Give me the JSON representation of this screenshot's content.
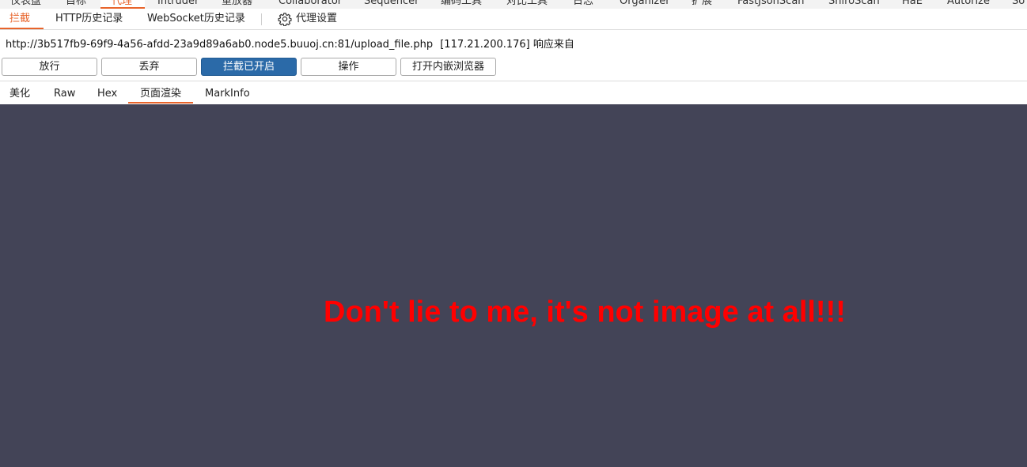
{
  "top_tabs": [
    {
      "label": "仪表盘"
    },
    {
      "label": "目标"
    },
    {
      "label": "代理",
      "active": true
    },
    {
      "label": "Intruder"
    },
    {
      "label": "重放器"
    },
    {
      "label": "Collaborator"
    },
    {
      "label": "Sequencer"
    },
    {
      "label": "编码工具"
    },
    {
      "label": "对比工具"
    },
    {
      "label": "日志"
    },
    {
      "label": "Organizer"
    },
    {
      "label": "扩展"
    },
    {
      "label": "FastJsonScan"
    },
    {
      "label": "ShiroScan"
    },
    {
      "label": "HaE"
    },
    {
      "label": "Autorize"
    },
    {
      "label": "So"
    }
  ],
  "sub_tabs": {
    "intercept": "拦截",
    "http_history": "HTTP历史记录",
    "websocket_history": "WebSocket历史记录",
    "proxy_settings": "代理设置"
  },
  "request_info": {
    "url": "http://3b517fb9-69f9-4a56-afdd-23a9d89a6ab0.node5.buuoj.cn:81/upload_file.php",
    "ip": "[117.21.200.176]",
    "note": "响应来自"
  },
  "buttons": {
    "forward": "放行",
    "drop": "丢弃",
    "intercept_on": "拦截已开启",
    "action": "操作",
    "open_browser": "打开内嵌浏览器"
  },
  "message_tabs": {
    "pretty": "美化",
    "raw": "Raw",
    "hex": "Hex",
    "render": "页面渲染",
    "markinfo": "MarkInfo"
  },
  "render": {
    "message": "Don't lie to me, it's not image at all!!!"
  },
  "colors": {
    "accent": "#e8642b",
    "primary_button": "#2b6aa8",
    "render_background": "#434457",
    "render_text": "#ff0000"
  },
  "icons": {
    "proxy_settings": "gear-icon"
  }
}
